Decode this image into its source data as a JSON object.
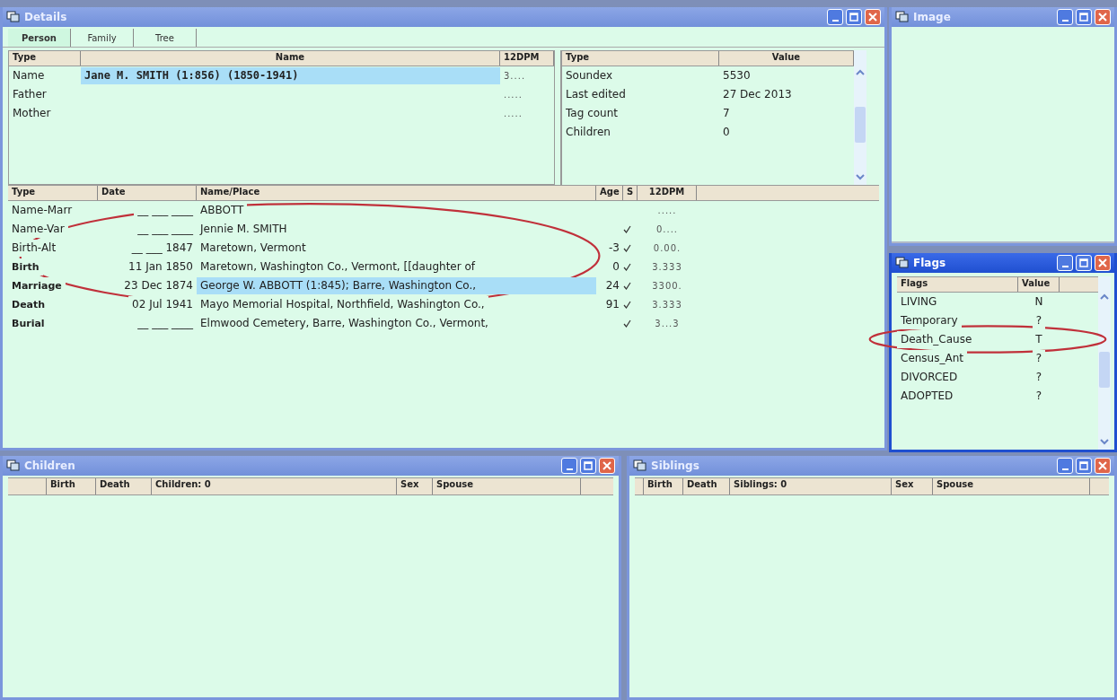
{
  "details": {
    "title": "Details",
    "active": false,
    "tabs": [
      {
        "label": "Person",
        "selected": true
      },
      {
        "label": "Family",
        "selected": false
      },
      {
        "label": "Tree",
        "selected": false
      }
    ],
    "name_table": {
      "columns": [
        "Type",
        "Name",
        "12DPM"
      ],
      "rows": [
        {
          "type": "Name",
          "name": "Jane M. SMITH (1:856)  (1850-1941)",
          "dpm": "3....",
          "selected": true
        },
        {
          "type": "Father",
          "dpm": ".....",
          "selected": false
        },
        {
          "type": "Mother",
          "dpm": ".....",
          "selected": false
        }
      ]
    },
    "info_table": {
      "columns": [
        "Type",
        "Value"
      ],
      "rows": [
        {
          "type": "Soundex",
          "value": "5530"
        },
        {
          "type": "Last edited",
          "value": "27 Dec 2013"
        },
        {
          "type": "Tag count",
          "value": "7"
        },
        {
          "type": "Children",
          "value": "0"
        }
      ]
    },
    "events_table": {
      "columns": [
        "Type",
        "Date",
        "Name/Place",
        "Age",
        "S",
        "12DPM"
      ],
      "rows": [
        {
          "type": "Name-Marr",
          "primary": false,
          "date": "__ ___ ____",
          "place": "ABBOTT",
          "dpm": ".....",
          "sourced": false,
          "selected": false
        },
        {
          "type": "Name-Var",
          "primary": false,
          "date": "__ ___ ____",
          "place": "Jennie M. SMITH",
          "dpm": "0....",
          "sourced": true,
          "selected": false
        },
        {
          "type": "Birth-Alt",
          "primary": false,
          "date": "__ ___ 1847",
          "place": "Maretown, Vermont",
          "age": "-3",
          "dpm": "0.00.",
          "sourced": true,
          "selected": false
        },
        {
          "type": "Birth",
          "primary": true,
          "date": "11 Jan 1850",
          "place": "Maretown, Washington Co., Vermont, [[daughter of",
          "age": "0",
          "dpm": "3.333",
          "sourced": true,
          "selected": false
        },
        {
          "type": "Marriage",
          "primary": true,
          "date": "23 Dec 1874",
          "place": "George W. ABBOTT (1:845); Barre, Washington Co.,",
          "age": "24",
          "dpm": "3300.",
          "sourced": true,
          "selected": true
        },
        {
          "type": "Death",
          "primary": true,
          "date": "02 Jul 1941",
          "place": "Mayo Memorial Hospital, Northfield, Washington Co.,",
          "age": "91",
          "dpm": "3.333",
          "sourced": true,
          "selected": false
        },
        {
          "type": "Burial",
          "primary": true,
          "date": "__ ___ ____",
          "place": "Elmwood Cemetery, Barre, Washington Co., Vermont,",
          "dpm": "3...3",
          "sourced": true,
          "selected": false
        }
      ]
    }
  },
  "image": {
    "title": "Image",
    "active": false
  },
  "flags": {
    "title": "Flags",
    "active": true,
    "columns": [
      "Flags",
      "Value"
    ],
    "rows": [
      {
        "flag": "LIVING",
        "value": "N"
      },
      {
        "flag": "Temporary",
        "value": "?"
      },
      {
        "flag": "Death_Cause",
        "value": "T"
      },
      {
        "flag": "Census_Ant",
        "value": "?"
      },
      {
        "flag": "DIVORCED",
        "value": "?"
      },
      {
        "flag": "ADOPTED",
        "value": "?"
      }
    ]
  },
  "children": {
    "title": "Children",
    "active": false,
    "columns": [
      "Birth",
      "Death",
      "Children: 0",
      "Sex",
      "Spouse"
    ]
  },
  "siblings": {
    "title": "Siblings",
    "active": false,
    "columns": [
      "Birth",
      "Death",
      "Siblings: 0",
      "Sex",
      "Spouse"
    ]
  },
  "annotations": [
    {
      "kind": "ellipse"
    },
    {
      "kind": "ellipse"
    }
  ]
}
